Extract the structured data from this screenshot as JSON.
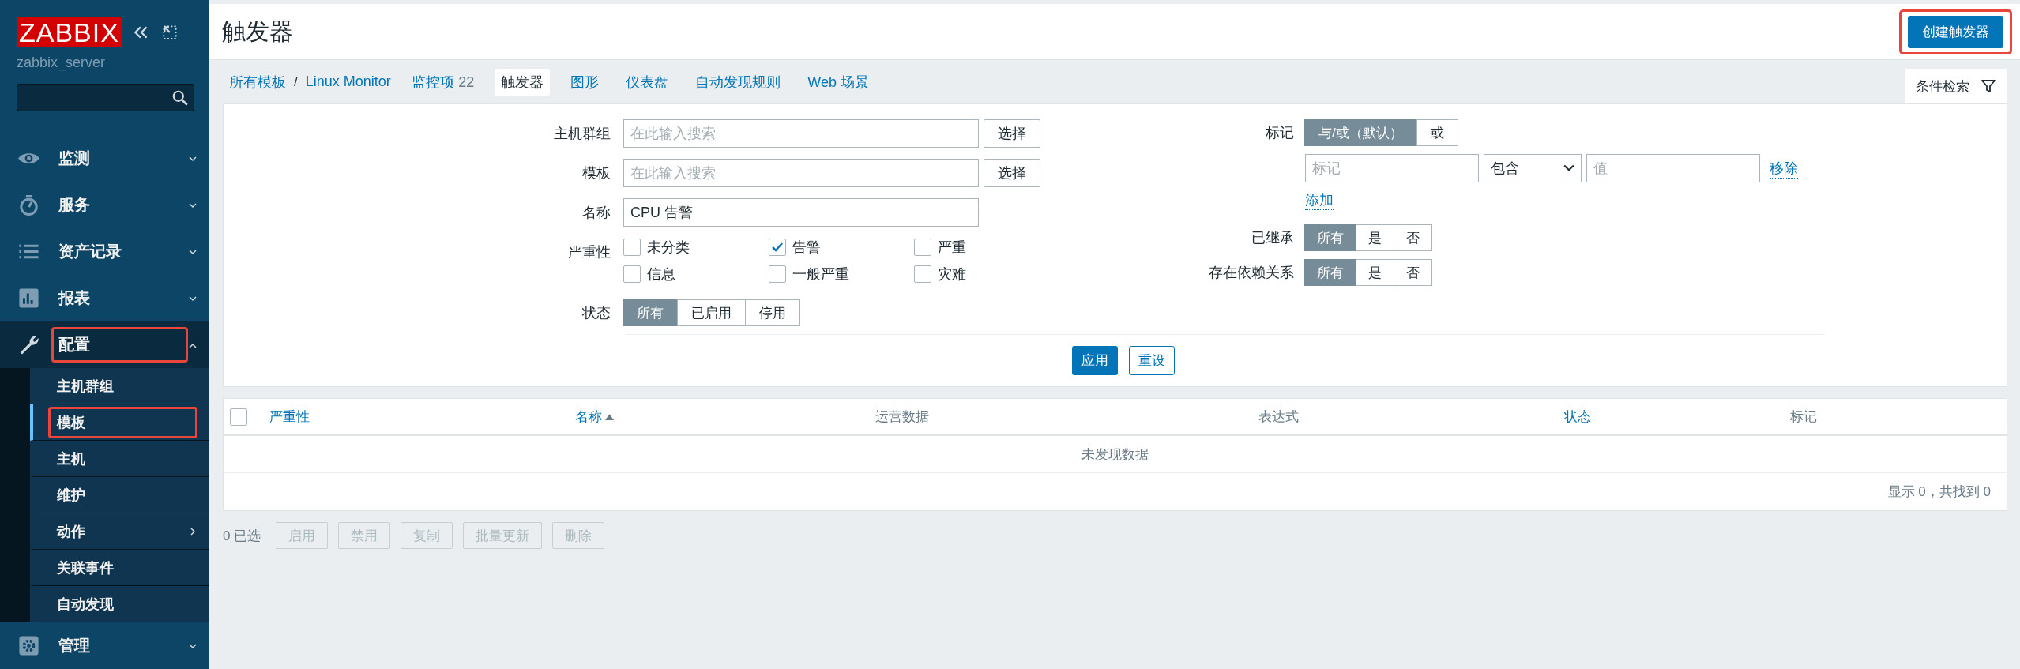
{
  "sidebar": {
    "logo": "ZABBIX",
    "server": "zabbix_server",
    "menu": [
      {
        "label": "监测",
        "expanded": false,
        "highlighted": false
      },
      {
        "label": "服务",
        "expanded": false,
        "highlighted": false
      },
      {
        "label": "资产记录",
        "expanded": false,
        "highlighted": false
      },
      {
        "label": "报表",
        "expanded": false,
        "highlighted": false
      },
      {
        "label": "配置",
        "expanded": true,
        "highlighted": true,
        "children": [
          {
            "label": "主机群组",
            "selected": false,
            "highlighted": false,
            "submenu": false
          },
          {
            "label": "模板",
            "selected": true,
            "highlighted": true,
            "submenu": false
          },
          {
            "label": "主机",
            "selected": false,
            "highlighted": false,
            "submenu": false
          },
          {
            "label": "维护",
            "selected": false,
            "highlighted": false,
            "submenu": false
          },
          {
            "label": "动作",
            "selected": false,
            "highlighted": false,
            "submenu": true
          },
          {
            "label": "关联事件",
            "selected": false,
            "highlighted": false,
            "submenu": false
          },
          {
            "label": "自动发现",
            "selected": false,
            "highlighted": false,
            "submenu": false
          }
        ]
      },
      {
        "label": "管理",
        "expanded": false,
        "highlighted": false
      }
    ]
  },
  "header": {
    "title": "触发器",
    "create_button": {
      "label": "创建触发器",
      "highlighted": true
    }
  },
  "nav": {
    "breadcrumbs": [
      "所有模板",
      "Linux Monitor"
    ],
    "separator": "/",
    "tabs": [
      {
        "label": "监控项",
        "count": "22",
        "selected": false
      },
      {
        "label": "触发器",
        "selected": true
      },
      {
        "label": "图形",
        "selected": false
      },
      {
        "label": "仪表盘",
        "selected": false
      },
      {
        "label": "自动发现规则",
        "selected": false
      },
      {
        "label": "Web 场景",
        "selected": false
      }
    ],
    "filter_toggle": "条件检索"
  },
  "filter": {
    "host_group": {
      "label": "主机群组",
      "placeholder": "在此输入搜索",
      "button": "选择"
    },
    "template": {
      "label": "模板",
      "placeholder": "在此输入搜索",
      "button": "选择"
    },
    "name": {
      "label": "名称",
      "value": "CPU 告警"
    },
    "severity": {
      "label": "严重性",
      "options": [
        {
          "label": "未分类",
          "checked": false
        },
        {
          "label": "告警",
          "checked": true
        },
        {
          "label": "严重",
          "checked": false
        },
        {
          "label": "信息",
          "checked": false
        },
        {
          "label": "一般严重",
          "checked": false
        },
        {
          "label": "灾难",
          "checked": false
        }
      ]
    },
    "status": {
      "label": "状态",
      "options": [
        {
          "label": "所有",
          "selected": true
        },
        {
          "label": "已启用",
          "selected": false
        },
        {
          "label": "停用",
          "selected": false
        }
      ]
    },
    "tags": {
      "label": "标记",
      "operators": [
        {
          "label": "与/或（默认）",
          "selected": true
        },
        {
          "label": "或",
          "selected": false
        }
      ],
      "tag_placeholder": "标记",
      "operator": "包含",
      "value_placeholder": "值",
      "remove": "移除",
      "add": "添加"
    },
    "inherited": {
      "label": "已继承",
      "options": [
        {
          "label": "所有",
          "selected": true
        },
        {
          "label": "是",
          "selected": false
        },
        {
          "label": "否",
          "selected": false
        }
      ]
    },
    "dependencies": {
      "label": "存在依赖关系",
      "options": [
        {
          "label": "所有",
          "selected": true
        },
        {
          "label": "是",
          "selected": false
        },
        {
          "label": "否",
          "selected": false
        }
      ]
    },
    "apply": "应用",
    "reset": "重设"
  },
  "table": {
    "select_all": {
      "checked": false
    },
    "columns": [
      {
        "label": "严重性",
        "sortable": true,
        "sorted": false
      },
      {
        "label": "名称",
        "sortable": true,
        "sorted": true
      },
      {
        "label": "运营数据",
        "sortable": false,
        "sorted": false
      },
      {
        "label": "表达式",
        "sortable": false,
        "sorted": false
      },
      {
        "label": "状态",
        "sortable": true,
        "sorted": false
      },
      {
        "label": "标记",
        "sortable": false,
        "sorted": false
      }
    ],
    "empty": "未发现数据",
    "footer": "显示 0，共找到 0"
  },
  "mass_actions": {
    "selected_count": "0 已选",
    "buttons": [
      {
        "label": "启用",
        "disabled": true
      },
      {
        "label": "禁用",
        "disabled": true
      },
      {
        "label": "复制",
        "disabled": true
      },
      {
        "label": "批量更新",
        "disabled": true
      },
      {
        "label": "删除",
        "disabled": true
      }
    ]
  }
}
